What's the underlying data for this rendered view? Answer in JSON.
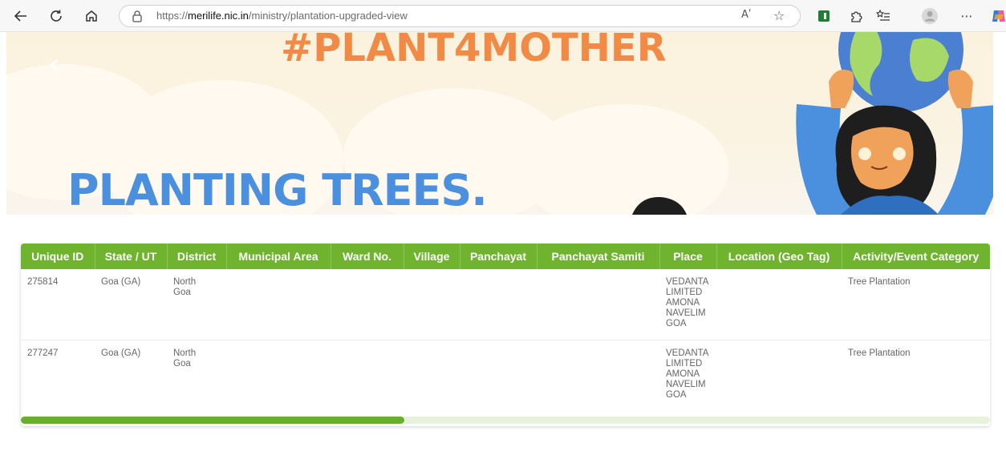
{
  "browser": {
    "url_prefix": "https://",
    "url_domain": "merilife.nic.in",
    "url_path": "/ministry/plantation-upgraded-view",
    "read_aloud_label": "Aʹ",
    "icons": [
      "back-icon",
      "refresh-icon",
      "home-icon",
      "lock-icon",
      "read-aloud-icon",
      "favorite-star-icon",
      "extension-icon",
      "extensions-puzzle-icon",
      "favorites-list-icon",
      "profile-avatar-icon",
      "more-menu-icon",
      "copilot-icon"
    ]
  },
  "banner": {
    "hashtag": "#PLANT4MOTHER",
    "headline": "PLANTING TREES.",
    "colors": {
      "hashtag": "#f08a45",
      "headline": "#4a90de",
      "background": "#fbf2de"
    }
  },
  "table": {
    "columns": [
      "Unique ID",
      "State / UT",
      "District",
      "Municipal Area",
      "Ward No.",
      "Village",
      "Panchayat",
      "Panchayat Samiti",
      "Place",
      "Location (Geo Tag)",
      "Activity/Event Category"
    ],
    "rows": [
      {
        "unique_id": "275814",
        "state": "Goa (GA)",
        "district": [
          "North",
          "Goa"
        ],
        "municipal_area": "",
        "ward_no": "",
        "village": "",
        "panchayat": "",
        "panchayat_samiti": "",
        "place": [
          "VEDANTA",
          "LIMITED",
          "AMONA",
          "NAVELIM",
          "GOA"
        ],
        "location": "",
        "activity": "Tree Plantation"
      },
      {
        "unique_id": "277247",
        "state": "Goa (GA)",
        "district": [
          "North",
          "Goa"
        ],
        "municipal_area": "",
        "ward_no": "",
        "village": "",
        "panchayat": "",
        "panchayat_samiti": "",
        "place": [
          "VEDANTA",
          "LIMITED",
          "AMONA",
          "NAVELIM",
          "GOA"
        ],
        "location": "",
        "activity": "Tree Plantation"
      }
    ],
    "colors": {
      "header_bg": "#6fb32f",
      "scrollbar": "#66b02c"
    }
  }
}
